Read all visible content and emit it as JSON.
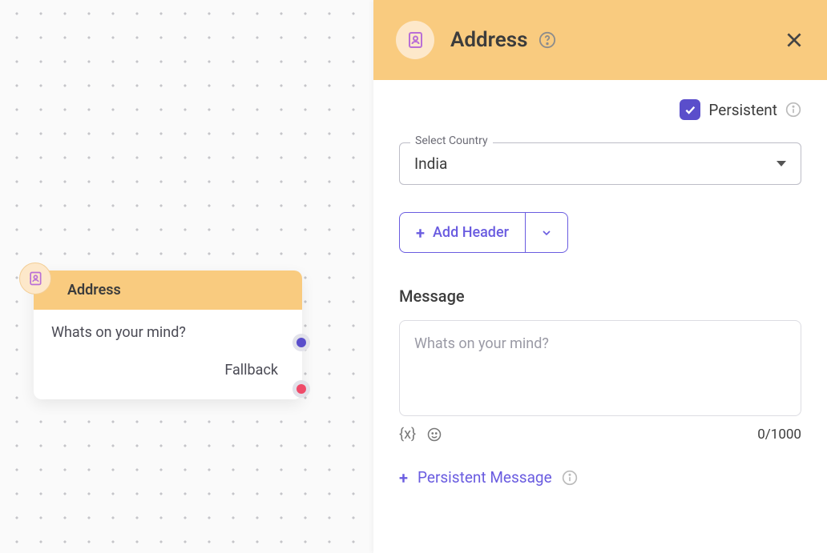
{
  "node": {
    "title": "Address",
    "prompt": "Whats on your mind?",
    "fallback_label": "Fallback"
  },
  "panel": {
    "title": "Address",
    "persistent_label": "Persistent",
    "persistent_checked": true,
    "country": {
      "label": "Select Country",
      "value": "India"
    },
    "add_header_label": "Add Header",
    "message": {
      "label": "Message",
      "placeholder": "Whats on your mind?",
      "value": "",
      "counter": "0/1000"
    },
    "persistent_message_label": "Persistent Message"
  }
}
